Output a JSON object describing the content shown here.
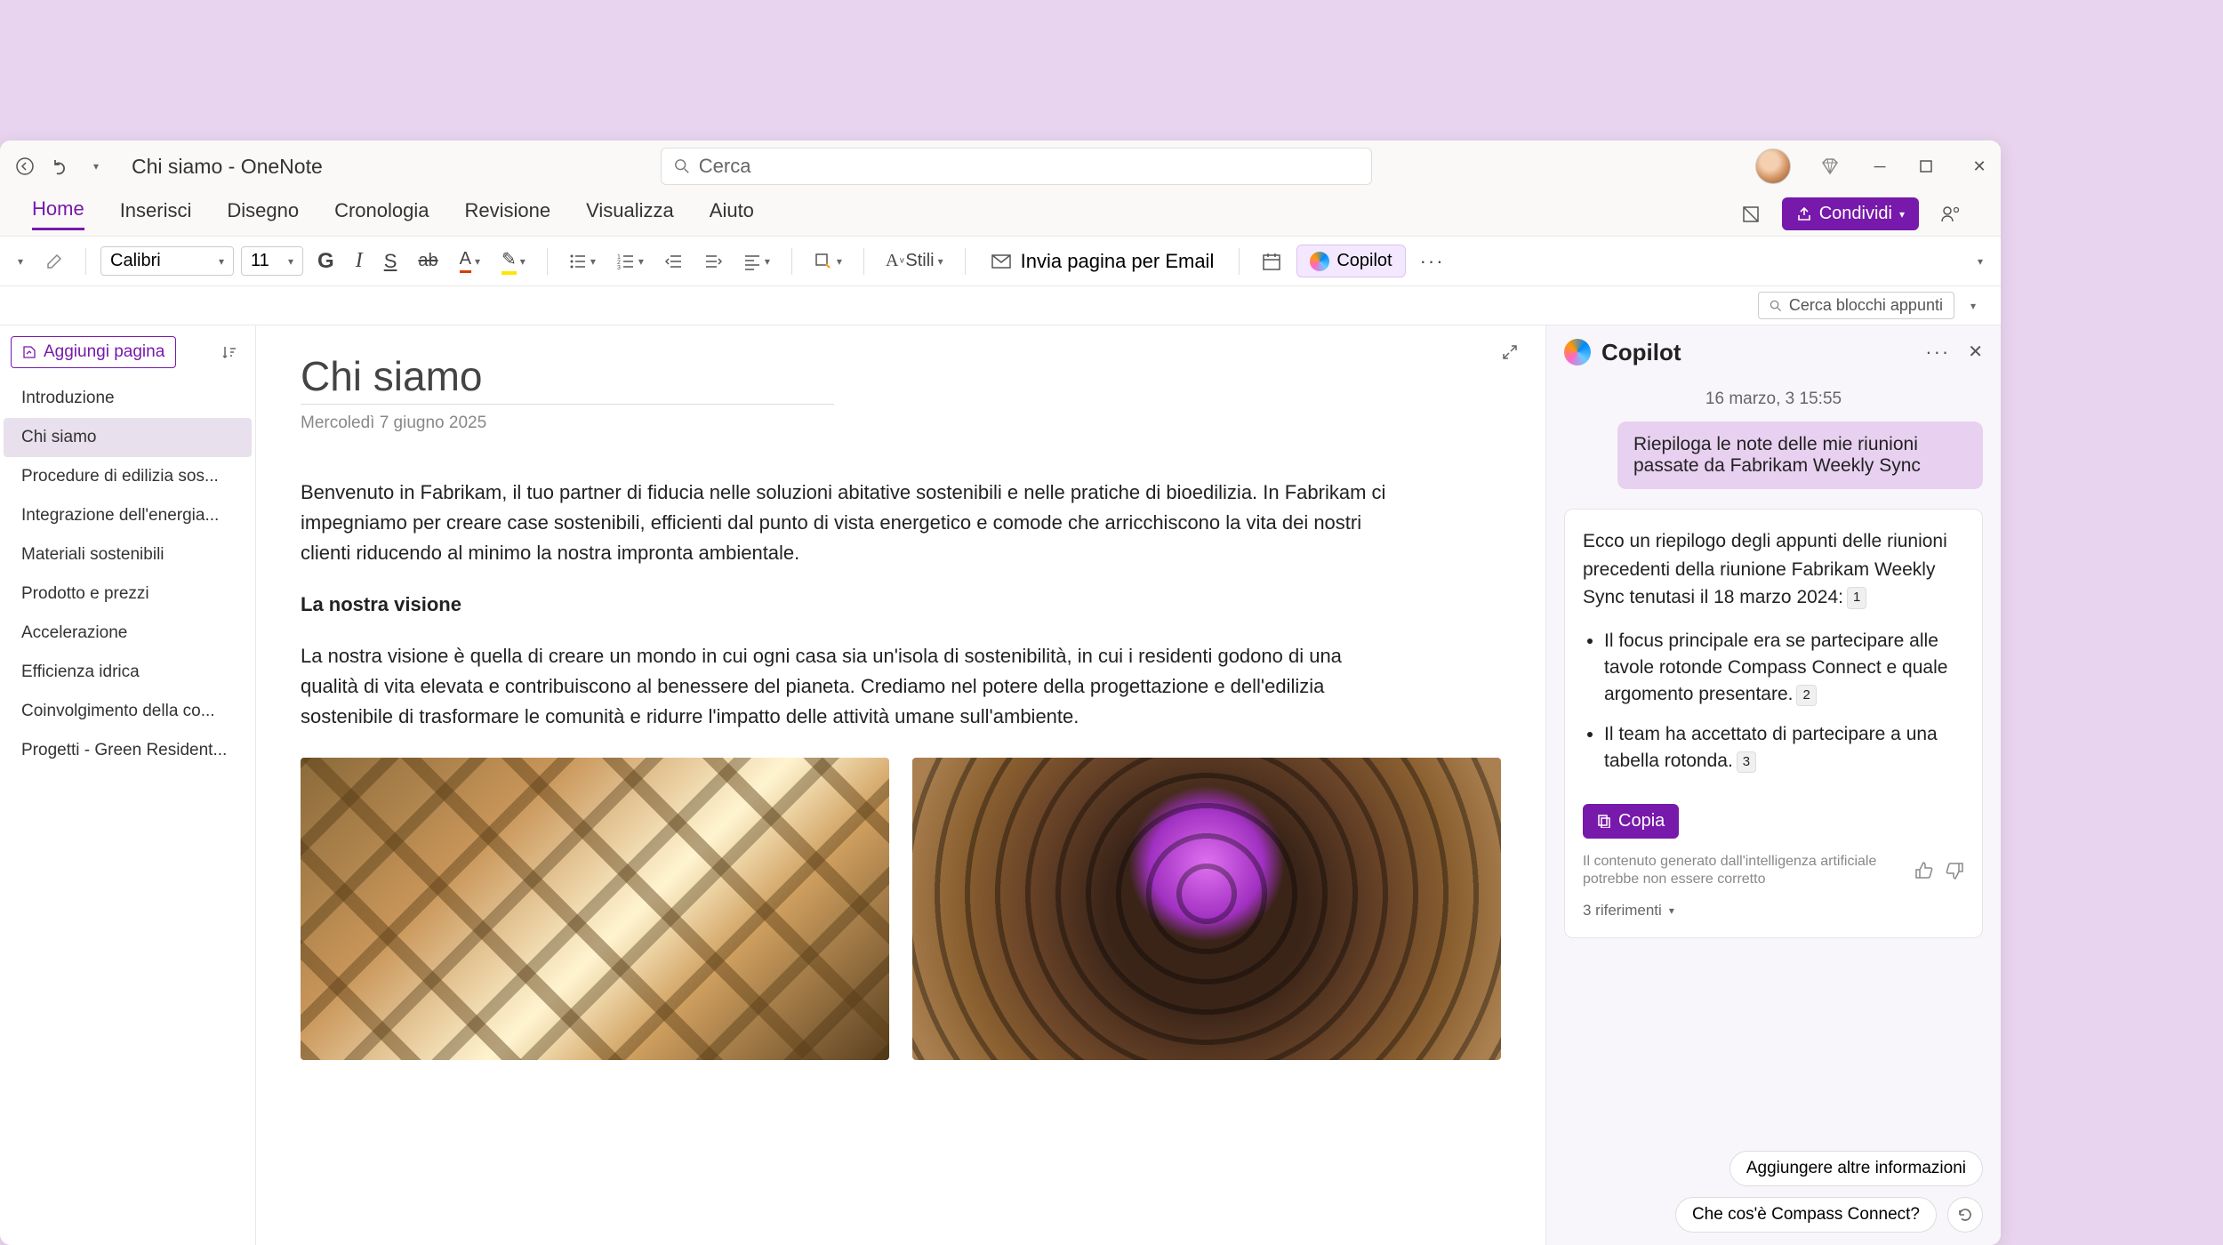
{
  "window": {
    "title": "Chi siamo - OneNote",
    "search_placeholder": "Cerca"
  },
  "ribbon": {
    "tabs": [
      "Home",
      "Inserisci",
      "Disegno",
      "Cronologia",
      "Revisione",
      "Visualizza",
      "Aiuto"
    ],
    "active_tab": "Home",
    "share_label": "Condividi"
  },
  "toolbar": {
    "font_name": "Calibri",
    "font_size": "11",
    "styles_label": "Stili",
    "email_label": "Invia pagina per Email",
    "copilot_label": "Copilot"
  },
  "secondary": {
    "search_notebooks": "Cerca blocchi appunti"
  },
  "sidebar": {
    "add_page": "Aggiungi pagina",
    "pages": [
      "Introduzione",
      "Chi siamo",
      "Procedure di edilizia sos...",
      "Integrazione dell'energia...",
      "Materiali sostenibili",
      "Prodotto e prezzi",
      "Accelerazione",
      "Efficienza idrica",
      "Coinvolgimento della co...",
      "Progetti - Green Resident..."
    ],
    "active_page": "Chi siamo"
  },
  "page": {
    "title": "Chi siamo",
    "date": "Mercoledì 7 giugno 2025",
    "intro": "Benvenuto in Fabrikam, il tuo partner di fiducia nelle soluzioni abitative sostenibili e nelle pratiche di bioedilizia. In Fabrikam ci impegniamo per creare case sostenibili, efficienti dal punto di vista energetico e comode che arricchiscono la vita dei nostri clienti riducendo al minimo la nostra impronta ambientale.",
    "vision_heading": "La nostra visione",
    "vision_text": "La nostra visione è quella di creare un mondo in cui ogni casa sia un'isola di sostenibilità, in cui i residenti godono di una qualità di vita elevata e contribuiscono al benessere del pianeta. Crediamo nel potere della progettazione e dell'edilizia sostenibile di trasformare le comunità e ridurre l'impatto delle attività umane sull'ambiente."
  },
  "copilot": {
    "title": "Copilot",
    "timestamp": "16 marzo, 3 15:55",
    "user_message": "Riepiloga le note delle mie riunioni passate da Fabrikam Weekly Sync",
    "ai_intro": "Ecco un riepilogo degli appunti delle riunioni precedenti della riunione Fabrikam Weekly Sync tenutasi il 18 marzo 2024:",
    "ai_ref_intro": "1",
    "bullets": [
      {
        "text": "Il focus principale era se partecipare alle tavole rotonde Compass Connect e quale argomento presentare.",
        "ref": "2"
      },
      {
        "text": "Il team ha accettato di partecipare a una tabella rotonda.",
        "ref": "3"
      }
    ],
    "copy_label": "Copia",
    "disclaimer": "Il contenuto generato dall'intelligenza artificiale potrebbe non essere corretto",
    "refs_toggle": "3 riferimenti",
    "suggestion1": "Aggiungere altre informazioni",
    "suggestion2": "Che cos'è Compass Connect?"
  }
}
